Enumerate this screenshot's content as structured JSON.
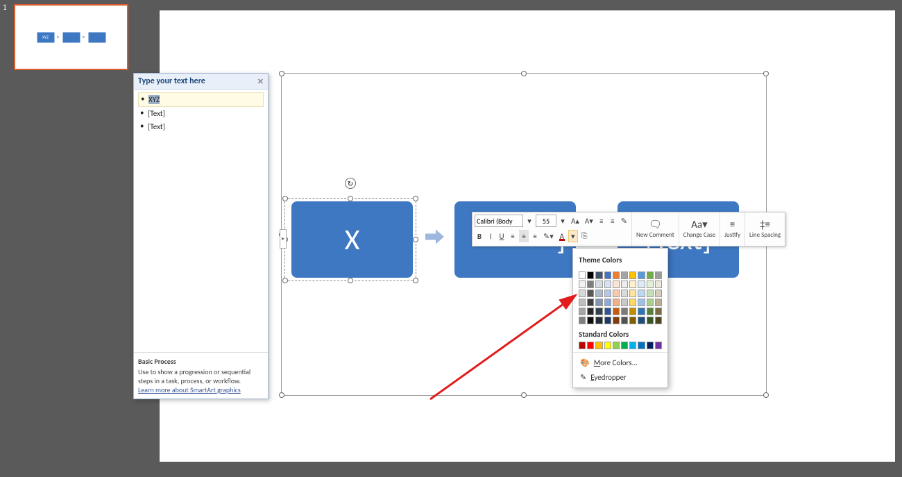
{
  "slide_number": "1",
  "thumb_box_label": "XYZ",
  "text_pane": {
    "header": "Type your text here",
    "items": [
      "XYZ",
      "[Text]",
      "[Text]"
    ],
    "footer_title": "Basic Process",
    "footer_desc": "Use to show a progression or sequential steps in a task, process, or workflow.",
    "footer_link": "Learn more about SmartArt graphics"
  },
  "flow": {
    "box1": "X",
    "box2": "]",
    "box3": "[Text]"
  },
  "mini_toolbar": {
    "font": "Calibri (Body",
    "size": "55",
    "new_comment": "New Comment",
    "change_case": "Change Case",
    "justify": "Justify",
    "line_spacing": "Line Spacing"
  },
  "color_dd": {
    "theme_label": "Theme Colors",
    "standard_label": "Standard Colors",
    "more_colors": "More Colors...",
    "eyedropper": "Eyedropper",
    "theme_row1": [
      "#ffffff",
      "#000000",
      "#44546a",
      "#4472c4",
      "#ed7d31",
      "#a5a5a5",
      "#ffc000",
      "#5b9bd5",
      "#70ad47",
      "#9e9e9e"
    ],
    "theme_shades": [
      [
        "#f2f2f2",
        "#7f7f7f",
        "#d5dce4",
        "#d9e2f3",
        "#fce5d5",
        "#ededed",
        "#fff2cc",
        "#deebf6",
        "#e2efd9",
        "#ece6dc"
      ],
      [
        "#d8d8d8",
        "#595959",
        "#acb9ca",
        "#b4c6e7",
        "#f7caac",
        "#dbdbdb",
        "#ffe599",
        "#bdd7ee",
        "#c5e0b3",
        "#d6ccbc"
      ],
      [
        "#bfbfbf",
        "#3f3f3f",
        "#8496b0",
        "#8eaadb",
        "#f4b083",
        "#c9c9c9",
        "#ffd965",
        "#9cc3e5",
        "#a8d08d",
        "#bdae93"
      ],
      [
        "#a5a5a5",
        "#262626",
        "#323f4f",
        "#2f5496",
        "#c55a11",
        "#7b7b7b",
        "#bf8f00",
        "#2e75b5",
        "#538135",
        "#7a6a45"
      ],
      [
        "#7f7f7f",
        "#0c0c0c",
        "#222a35",
        "#1f3864",
        "#833c0b",
        "#525252",
        "#7f6000",
        "#1e4e79",
        "#375623",
        "#4e431f"
      ]
    ],
    "standard": [
      "#c00000",
      "#ff0000",
      "#ffc000",
      "#ffff00",
      "#92d050",
      "#00b050",
      "#00b0f0",
      "#0070c0",
      "#002060",
      "#7030a0"
    ]
  }
}
